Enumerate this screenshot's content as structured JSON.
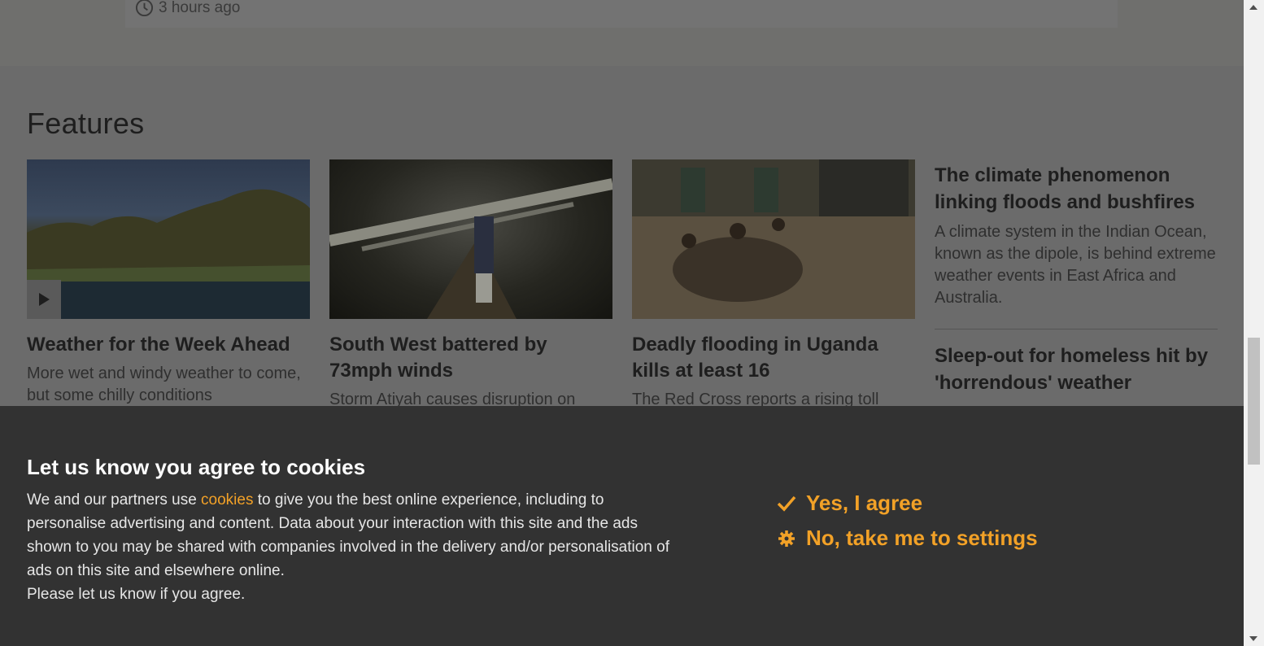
{
  "top_card": {
    "time_label": "3 hours ago"
  },
  "features": {
    "heading": "Features",
    "cards": [
      {
        "title": "Weather for the Week Ahead",
        "summary": "More wet and windy weather to come, but some chilly conditions"
      },
      {
        "title": "South West battered by 73mph winds",
        "summary": "Storm Atiyah causes disruption on"
      },
      {
        "title": "Deadly flooding in Uganda kills at least 16",
        "summary": "The Red Cross reports a rising toll"
      }
    ],
    "side_items": [
      {
        "title": "The climate phenomenon linking floods and bushfires",
        "summary": "A climate system in the Indian Ocean, known as the dipole, is behind extreme weather events in East Africa and Australia."
      },
      {
        "title": "Sleep-out for homeless hit by 'horrendous' weather"
      }
    ]
  },
  "cookie_banner": {
    "title": "Let us know you agree to cookies",
    "text_before_link": "We and our partners use ",
    "link_text": "cookies",
    "text_after_link": " to give you the best online experience, including to personalise advertising and content. Data about your interaction with this site and the ads shown to you may be shared with companies involved in the delivery and/or personalisation of ads on this site and elsewhere online.",
    "text_final": "Please let us know if you agree.",
    "agree_label": "Yes, I agree",
    "settings_label": "No, take me to settings",
    "accent_color": "#f2a127"
  }
}
